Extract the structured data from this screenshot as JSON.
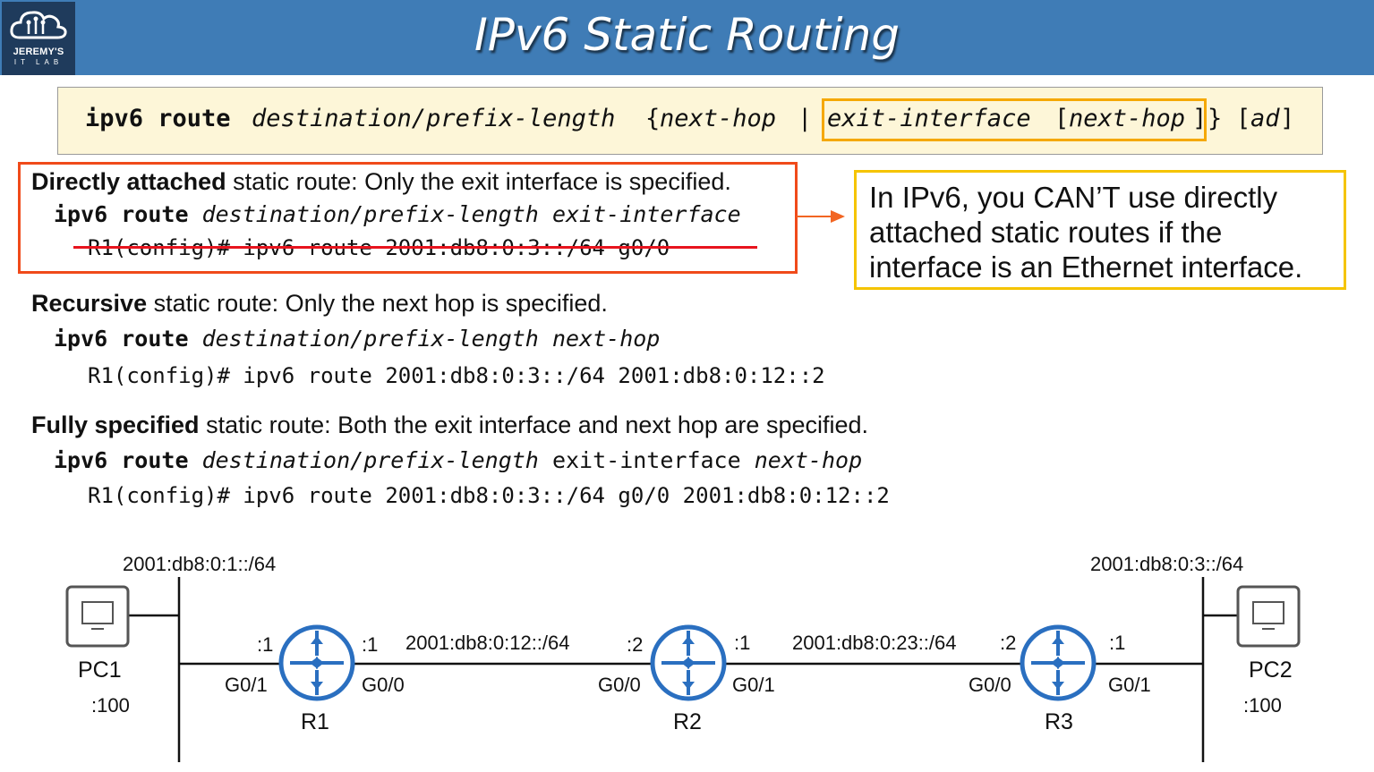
{
  "header": {
    "title": "IPv6 Static Routing",
    "logo_line1": "JEREMY'S",
    "logo_line2": "IT LAB",
    "bg_color": "#3f7cb6"
  },
  "syntax": {
    "kw": "ipv6 route",
    "dest": "destination/prefix-length",
    "brace_open": "{",
    "next_hop": "next-hop",
    "pipe": "|",
    "exit_if": "exit-interface",
    "bracket_open": "[",
    "opt_next_hop": "next-hop",
    "bracket_close": "]",
    "brace_close": "}",
    "ad_open": "[",
    "ad": "ad",
    "ad_close": "]"
  },
  "directly_attached": {
    "heading": "Directly attached",
    "desc": " static route: Only the exit interface is specified.",
    "kw": "ipv6 route",
    "dest": "destination/prefix-length",
    "exit": "exit-interface",
    "example": "R1(config)# ipv6 route 2001:db8:0:3::/64 g0/0"
  },
  "note": {
    "text": "In IPv6, you CAN’T use directly attached static routes if the interface is an Ethernet interface."
  },
  "recursive": {
    "heading": "Recursive",
    "desc": " static route: Only the next hop is specified.",
    "kw": "ipv6 route",
    "dest": "destination/prefix-length",
    "next_hop": "next-hop",
    "example": "R1(config)# ipv6 route 2001:db8:0:3::/64 2001:db8:0:12::2"
  },
  "fully_specified": {
    "heading": "Fully specified",
    "desc": " static route: Both the exit interface and next hop are specified.",
    "kw": "ipv6 route",
    "dest": "destination/prefix-length",
    "exit": "exit-interface",
    "next_hop": "next-hop",
    "example": "R1(config)# ipv6 route 2001:db8:0:3::/64 g0/0 2001:db8:0:12::2"
  },
  "topology": {
    "lan1": "2001:db8:0:1::/64",
    "lan3": "2001:db8:0:3::/64",
    "link12": "2001:db8:0:12::/64",
    "link23": "2001:db8:0:23::/64",
    "pc1": {
      "name": "PC1",
      "host": ":100"
    },
    "pc2": {
      "name": "PC2",
      "host": ":100"
    },
    "r1": {
      "name": "R1",
      "left_if": "G0/1",
      "left_host": ":1",
      "right_if": "G0/0",
      "right_host": ":1"
    },
    "r2": {
      "name": "R2",
      "left_if": "G0/0",
      "left_host": ":2",
      "right_if": "G0/1",
      "right_host": ":1"
    },
    "r3": {
      "name": "R3",
      "left_if": "G0/0",
      "left_host": ":2",
      "right_if": "G0/1",
      "right_host": ":1"
    },
    "router_color": "#2a6fc0",
    "strike_color": "#e8141e"
  }
}
